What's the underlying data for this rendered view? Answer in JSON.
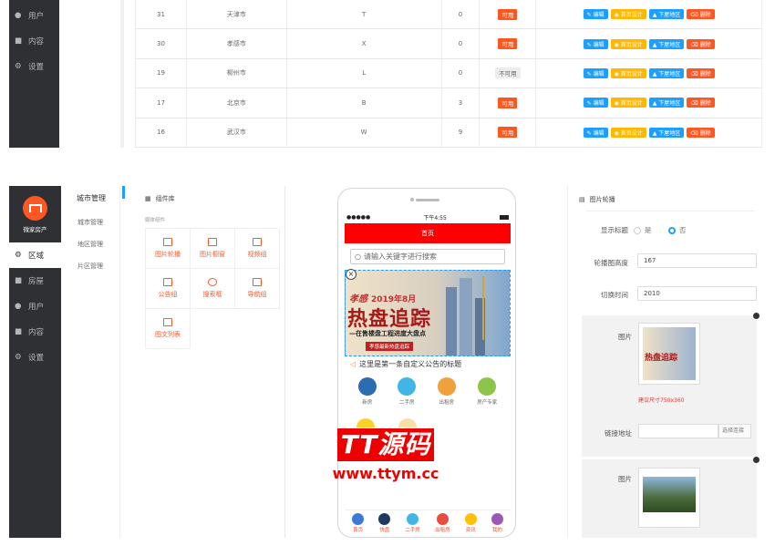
{
  "top_sidebar": {
    "items": [
      {
        "label": "用户"
      },
      {
        "label": "内容"
      },
      {
        "label": "设置"
      }
    ]
  },
  "table": {
    "rows": [
      {
        "id": "31",
        "name": "天津市",
        "letter": "T",
        "count": "0",
        "status": "可用",
        "on": true
      },
      {
        "id": "30",
        "name": "孝感市",
        "letter": "X",
        "count": "0",
        "status": "可用",
        "on": true
      },
      {
        "id": "19",
        "name": "柳州市",
        "letter": "L",
        "count": "0",
        "status": "不可用",
        "on": false
      },
      {
        "id": "17",
        "name": "北京市",
        "letter": "B",
        "count": "3",
        "status": "可用",
        "on": true
      },
      {
        "id": "16",
        "name": "武汉市",
        "letter": "W",
        "count": "9",
        "status": "可用",
        "on": true
      }
    ],
    "actions": {
      "edit": "编辑",
      "home": "首页设计",
      "down": "下屋地区",
      "del": "删除"
    }
  },
  "sidebar": {
    "brand": "微家房产",
    "items": [
      {
        "label": "区域",
        "active": true
      },
      {
        "label": "房屋"
      },
      {
        "label": "用户"
      },
      {
        "label": "内容"
      },
      {
        "label": "设置"
      }
    ]
  },
  "submenu": {
    "title": "城市管理",
    "items": [
      "城市管理",
      "地区管理",
      "片区管理"
    ]
  },
  "components": {
    "title": "组件库",
    "subtitle": "媒体组件",
    "items": [
      "图片轮播",
      "图片橱窗",
      "视频组",
      "公告组",
      "搜索框",
      "导航组",
      "图文列表"
    ]
  },
  "phone": {
    "carrier": "●●●●●",
    "time": "下午4:55",
    "title": "首页",
    "search_placeholder": "请输入关键字进行搜索",
    "banner": {
      "tag": "孝感",
      "date": "2019年8月",
      "headline": "热盘追踪",
      "sub": "—在售楼盘工程进度大盘点",
      "strip": "孝感最新热盘追踪"
    },
    "notice": "这里是第一条自定义公告的标题",
    "quick": [
      "新房",
      "二手房",
      "出租房",
      "房产专家"
    ],
    "tabs": [
      "首页",
      "快盘",
      "二手房",
      "出租房",
      "资讯",
      "我的"
    ]
  },
  "props": {
    "title": "图片轮播",
    "show_title_label": "显示标题",
    "opt_yes": "是",
    "opt_no": "否",
    "height_label": "轮播图高度",
    "height_value": "167",
    "interval_label": "切换时间",
    "interval_value": "2010",
    "image_label": "图片",
    "thumb_text": "热盘追踪",
    "size_hint": "建议尺寸750x360",
    "link_label": "链接地址",
    "link_btn": "选择连接",
    "image2_label": "图片"
  },
  "watermark": {
    "brand": "TT源码",
    "url": "www.ttym.cc"
  }
}
